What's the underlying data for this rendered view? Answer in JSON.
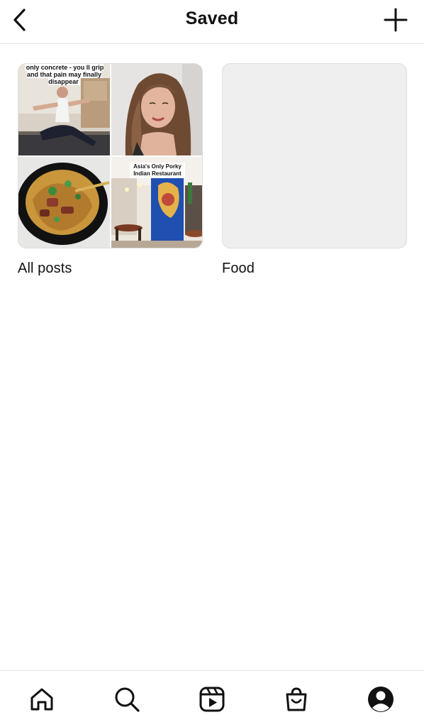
{
  "header": {
    "title": "Saved",
    "back_icon": "chevron-left-icon",
    "add_icon": "plus-icon"
  },
  "collections": [
    {
      "name": "All posts",
      "thumbnails": [
        {
          "caption": "only concrete - you ll grip and that pain may finally disappear",
          "icon": "yoga-stretch-photo"
        },
        {
          "icon": "woman-portrait-photo"
        },
        {
          "icon": "noodle-bowl-photo"
        },
        {
          "caption": "Asia's Only Porky Indian Restaurant",
          "icon": "restaurant-interior-photo"
        }
      ]
    },
    {
      "name": "Food",
      "thumbnails": []
    }
  ],
  "tabbar": {
    "items": [
      {
        "icon": "home-icon"
      },
      {
        "icon": "search-icon"
      },
      {
        "icon": "reels-icon"
      },
      {
        "icon": "shop-icon"
      },
      {
        "icon": "profile-icon"
      }
    ]
  },
  "colors": {
    "text": "#111111",
    "divider": "#e6e6e6",
    "empty_cover": "#efefef"
  }
}
